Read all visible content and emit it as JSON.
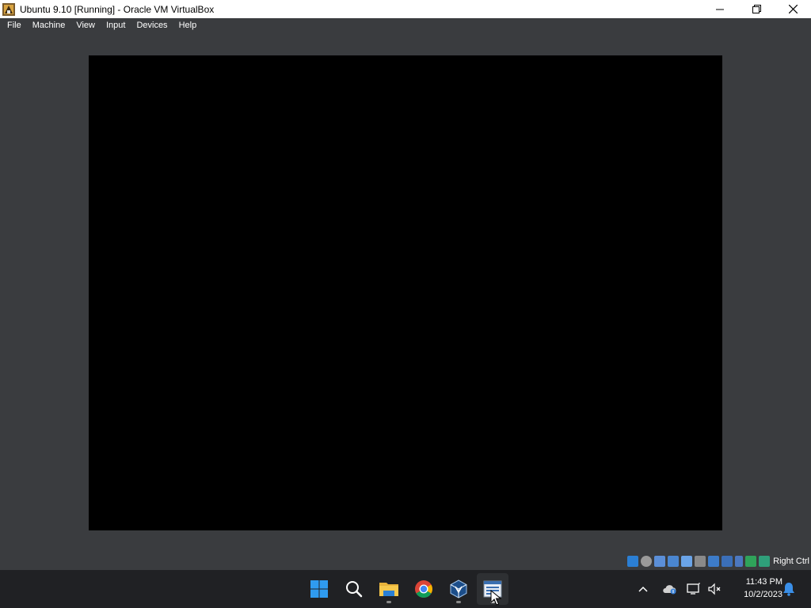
{
  "window": {
    "title": "Ubuntu 9.10 [Running] - Oracle VM VirtualBox",
    "icon": "virtualbox-vm-icon",
    "controls": [
      "minimize-icon",
      "maximize-icon",
      "close-icon"
    ]
  },
  "menu": {
    "items": [
      {
        "label": "File"
      },
      {
        "label": "Machine"
      },
      {
        "label": "View"
      },
      {
        "label": "Input"
      },
      {
        "label": "Devices"
      },
      {
        "label": "Help"
      }
    ]
  },
  "statusbar": {
    "icons": [
      "hard-disk-icon",
      "optical-drive-icon",
      "audio-icon",
      "network-icon",
      "usb-icon",
      "shared-folder-icon",
      "display-icon",
      "recording-icon",
      "cpu-icon",
      "mouse-integration-icon",
      "keyboard-capture-icon"
    ],
    "host_key": "Right Ctrl"
  },
  "taskbar": {
    "apps": [
      "windows-start-icon",
      "search-icon",
      "file-explorer-icon",
      "chrome-icon",
      "virtualbox-icon",
      "virtualbox-vm-window-icon"
    ],
    "tray": [
      "show-hidden-icons-chevron",
      "onedrive-icon",
      "network-icon",
      "volume-muted-icon"
    ],
    "time": "11:43 PM",
    "date": "10/2/2023",
    "notification_icon": "bell-icon"
  },
  "colors": {
    "window_bg": "#3a3c3f",
    "vm_screen": "#000000",
    "taskbar_bg": "#202124",
    "titlebar_bg": "#ffffff"
  }
}
